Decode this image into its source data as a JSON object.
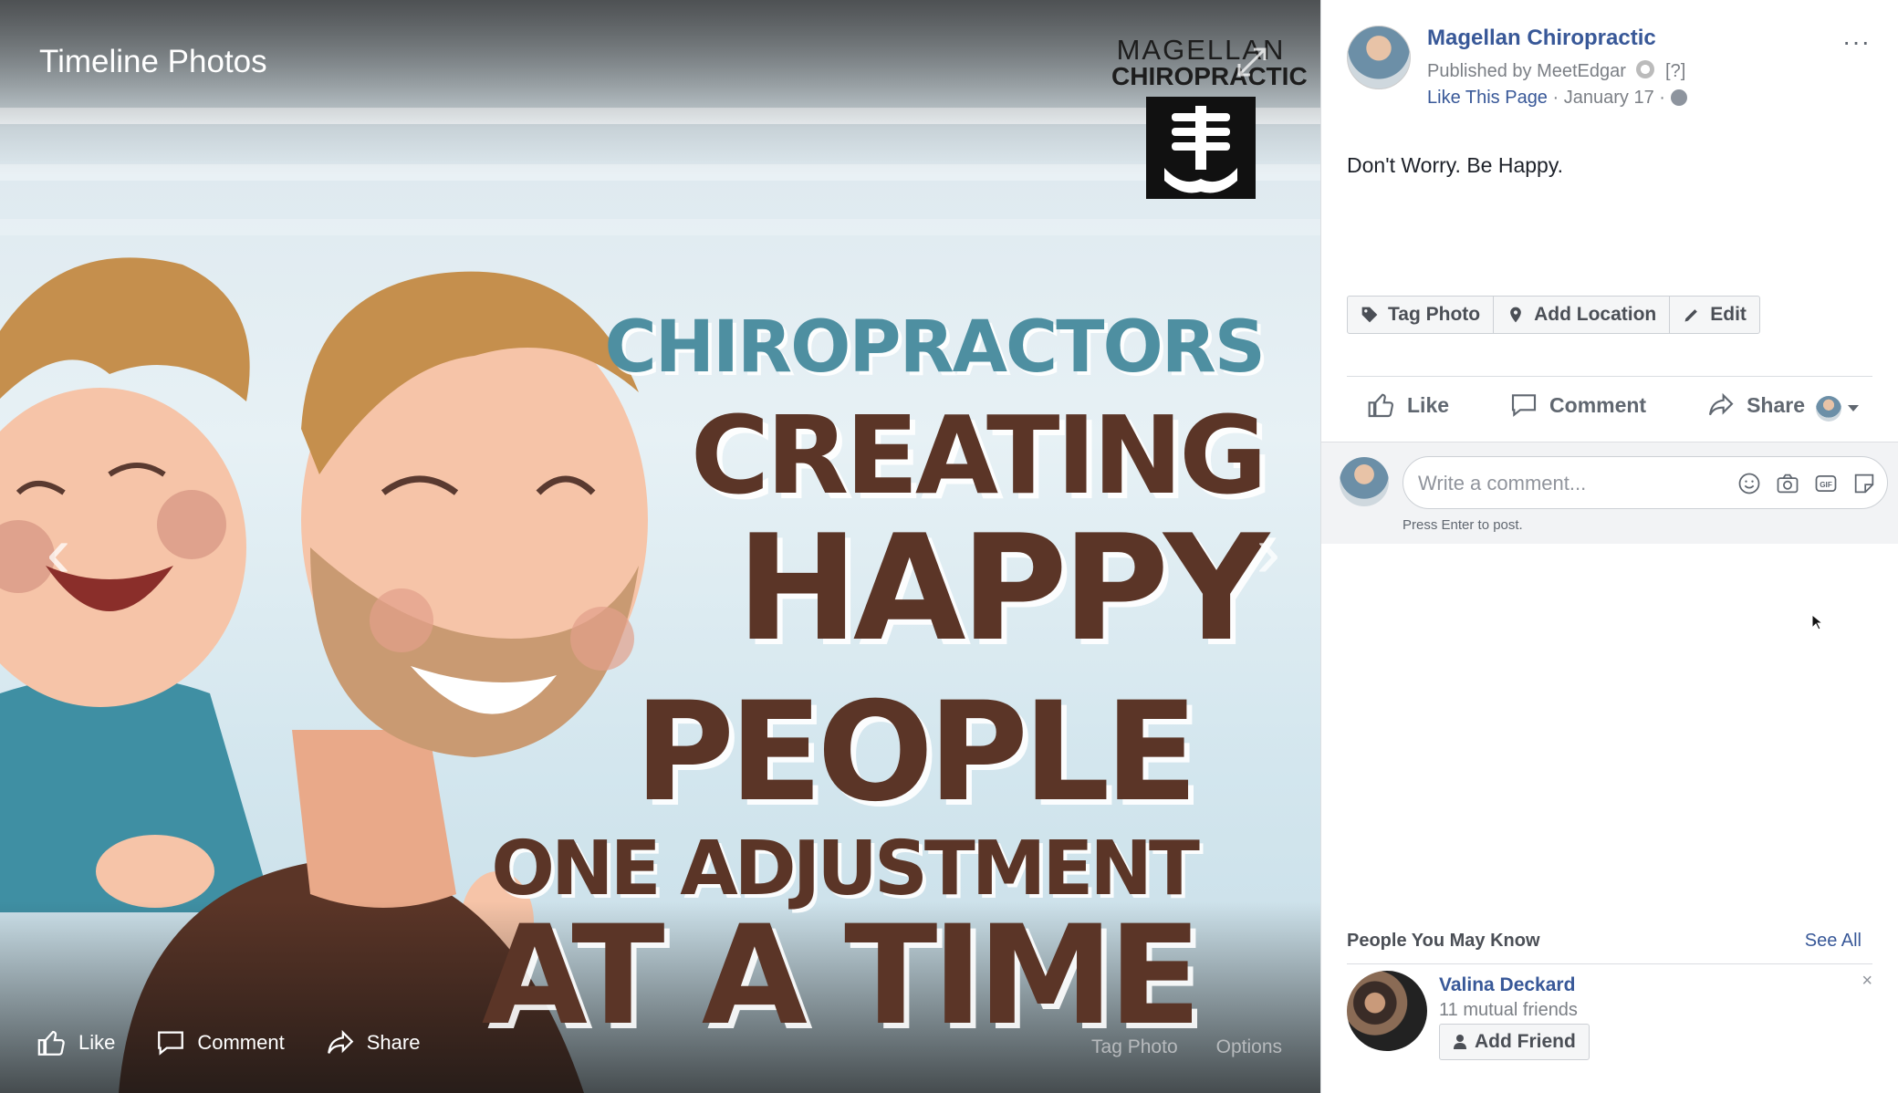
{
  "viewer": {
    "title": "Timeline Photos",
    "brand_line1": "MAGELLAN",
    "brand_line2": "CHIROPRACTIC",
    "headline": [
      "CHIROPRACTORS",
      "CREATING",
      "HAPPY",
      "PEOPLE",
      "ONE ADJUSTMENT",
      "AT A TIME"
    ],
    "actions": {
      "like": "Like",
      "comment": "Comment",
      "share": "Share"
    },
    "tag_photo": "Tag Photo",
    "options": "Options"
  },
  "post": {
    "page_name": "Magellan Chiropractic",
    "published_by": "Published by MeetEdgar",
    "published_q": "[?]",
    "like_page": "Like This Page",
    "date": "January 17",
    "dot": "·",
    "more": "···",
    "text": "Don't Worry. Be Happy.",
    "tools": {
      "tag_photo": "Tag Photo",
      "add_location": "Add Location",
      "edit": "Edit"
    },
    "actions": {
      "like": "Like",
      "comment": "Comment",
      "share": "Share"
    }
  },
  "comment": {
    "placeholder": "Write a comment...",
    "press_enter": "Press Enter to post."
  },
  "pymk": {
    "heading": "People You May Know",
    "see_all": "See All",
    "person": {
      "name": "Valina Deckard",
      "mutual": "11 mutual friends",
      "add_friend": "Add Friend",
      "close": "×"
    }
  },
  "colors": {
    "link": "#385898",
    "headline_blue": "#4e8fa1",
    "headline_brown": "#5b3527"
  }
}
